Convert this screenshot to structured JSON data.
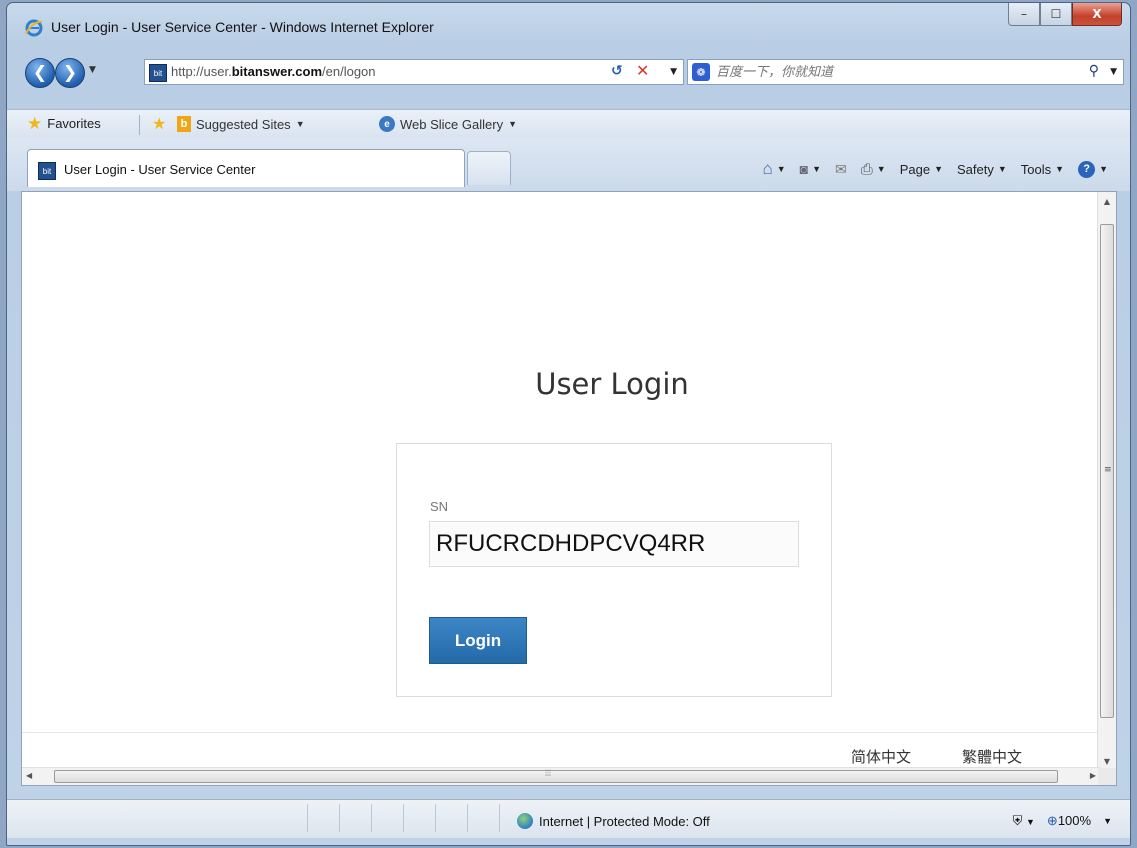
{
  "window": {
    "title": "User Login - User Service Center - Windows Internet Explorer",
    "minimize": "–",
    "maximize": "☐",
    "close": "X"
  },
  "address_bar": {
    "url_prefix": "http://user.",
    "url_domain": "bitanswer.com",
    "url_path": "/en/logon",
    "search_placeholder": "百度一下，你就知道"
  },
  "favorites_bar": {
    "favorites_label": "Favorites",
    "items": [
      {
        "label": "Suggested Sites",
        "icon": "bing-icon"
      },
      {
        "label": "Web Slice Gallery",
        "icon": "ie-icon"
      }
    ]
  },
  "tab": {
    "label": "User Login - User Service Center"
  },
  "command_bar": {
    "page": "Page",
    "safety": "Safety",
    "tools": "Tools"
  },
  "page": {
    "title": "User Login",
    "sn_label": "SN",
    "sn_value": "RFUCRCDHDPCVQ4RR",
    "login_button": "Login",
    "languages": [
      "简体中文",
      "繁體中文"
    ]
  },
  "status_bar": {
    "zone": "Internet | Protected Mode: Off",
    "zoom": "100%"
  },
  "colors": {
    "primary_button": "#2d77b8",
    "frame": "#bfd2e8"
  }
}
